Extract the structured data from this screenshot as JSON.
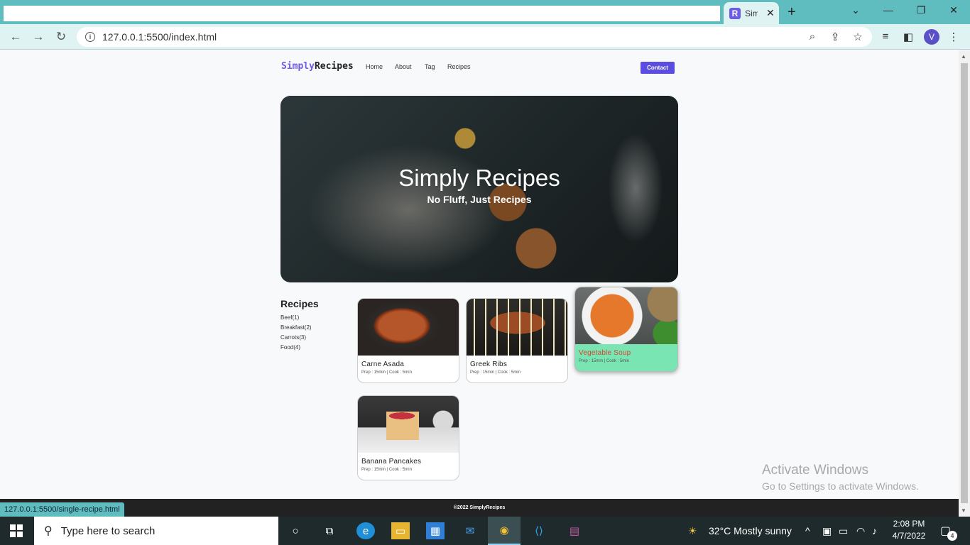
{
  "browser": {
    "tab_title": "Sim",
    "tab_favicon": "R",
    "tab_close": "✕",
    "new_tab": "+",
    "url": "127.0.0.1:5500/index.html",
    "avatar_letter": "V",
    "icons": {
      "back": "←",
      "forward": "→",
      "reload": "↻",
      "info": "i",
      "zoom": "⌕",
      "share": "⇪",
      "bookmark": "☆",
      "playlist": "≡",
      "sidepanel": "◧",
      "menu": "⋮",
      "tab_search": "⌄",
      "minimize": "—",
      "restore": "❐",
      "close": "✕"
    },
    "status_url": "127.0.0.1:5500/single-recipe.html"
  },
  "site": {
    "logo_part1": "Simply",
    "logo_part2": "Recipes",
    "nav": [
      "Home",
      "About",
      "Tag",
      "Recipes"
    ],
    "contact_label": "Contact",
    "hero_title": "Simply Recipes",
    "hero_subtitle": "No Fluff, Just Recipes",
    "sidebar_title": "Recipes",
    "tags": [
      "Beef(1)",
      "Breakfast(2)",
      "Carrots(3)",
      "Food(4)"
    ],
    "recipes": [
      {
        "name": "Carne Asada",
        "meta": "Prep : 15min | Cook : 5min"
      },
      {
        "name": "Greek Ribs",
        "meta": "Prep : 15min | Cook : 5min"
      },
      {
        "name": "Vegetable Soup",
        "meta": "Prep : 15min | Cook : 5min"
      },
      {
        "name": "Banana Pancakes",
        "meta": "Prep : 15min | Cook : 5min"
      }
    ],
    "footer": "©2022 SimplyRecipes"
  },
  "watermark": {
    "line1": "Activate Windows",
    "line2": "Go to Settings to activate Windows."
  },
  "taskbar": {
    "search_placeholder": "Type here to search",
    "weather": "32°C  Mostly sunny",
    "time": "2:08 PM",
    "date": "4/7/2022",
    "notification_count": "4",
    "icons": {
      "search": "⚲",
      "cortana": "○",
      "taskview": "⧉",
      "edge": "e",
      "explorer": "▭",
      "store": "▦",
      "mail": "✉",
      "chrome": "◉",
      "vscode": "⟨⟩",
      "winrar": "▤",
      "weather": "☀",
      "tray_up": "^",
      "tray_meet": "▣",
      "tray_battery": "▭",
      "tray_wifi": "◠",
      "tray_volume": "♪",
      "notification": "▢"
    }
  },
  "colors": {
    "accent": "#6c5ce7",
    "hover_card": "#79e5b2",
    "hover_title": "#d64535",
    "chrome_teal": "#5fbcbf"
  }
}
